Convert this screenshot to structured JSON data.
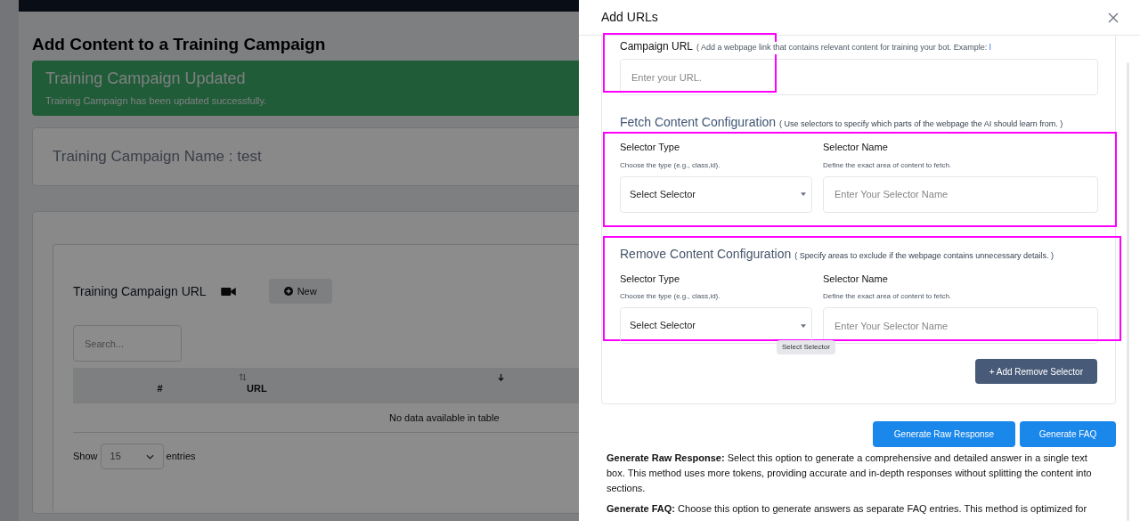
{
  "page": {
    "title": "Add Content to a Training Campaign",
    "alert": {
      "title": "Training Campaign Updated",
      "message": "Training Campaign has been updated successfully."
    },
    "campaign_name": "Training Campaign Name : test",
    "url_section": {
      "title": "Training Campaign URL",
      "new_button": "New",
      "search_placeholder": "Search...",
      "columns": [
        "#",
        "URL"
      ],
      "empty_message": "No data available in table",
      "show_label": "Show",
      "page_size": "15",
      "entries_label": "entries"
    }
  },
  "modal": {
    "title": "Add URLs",
    "campaign_url": {
      "label": "Campaign URL",
      "hint": "( Add a webpage link that contains relevant content for training your bot. Example:",
      "hint_link": "l",
      "placeholder": "Enter your URL."
    },
    "sections": [
      {
        "kind": "fetch",
        "title": "Fetch Content Configuration",
        "note": "( Use selectors to specify which parts of the webpage the AI should learn from. )",
        "type_label": "Selector Type",
        "type_hint": "Choose the type (e.g., class,id).",
        "select_value": "Select Selector",
        "name_label": "Selector Name",
        "name_hint": "Define the exact area of content to fetch.",
        "name_placeholder": "Enter Your Selector Name"
      },
      {
        "kind": "remove",
        "title": "Remove Content Configuration",
        "note": "( Specify areas to exclude if the webpage contains unnecessary details. )",
        "type_label": "Selector Type",
        "type_hint": "Choose the type (e.g., class,id).",
        "select_value": "Select Selector",
        "name_label": "Selector Name",
        "name_hint": "Define the exact area of content to fetch.",
        "name_placeholder": "Enter Your Selector Name",
        "tooltip": "Select Selector"
      }
    ],
    "add_button": "+ Add Remove Selector",
    "buttons": [
      "Generate Raw Response",
      "Generate FAQ"
    ],
    "descriptions": [
      "**Generate Raw Response:** Select this option to generate a comprehensive and detailed answer in a single text box. This method uses more tokens, providing accurate and in-depth responses without splitting the content into sections.",
      "**Generate FAQ:** Choose this option to generate answers as separate FAQ entries. This method is optimized for"
    ]
  }
}
